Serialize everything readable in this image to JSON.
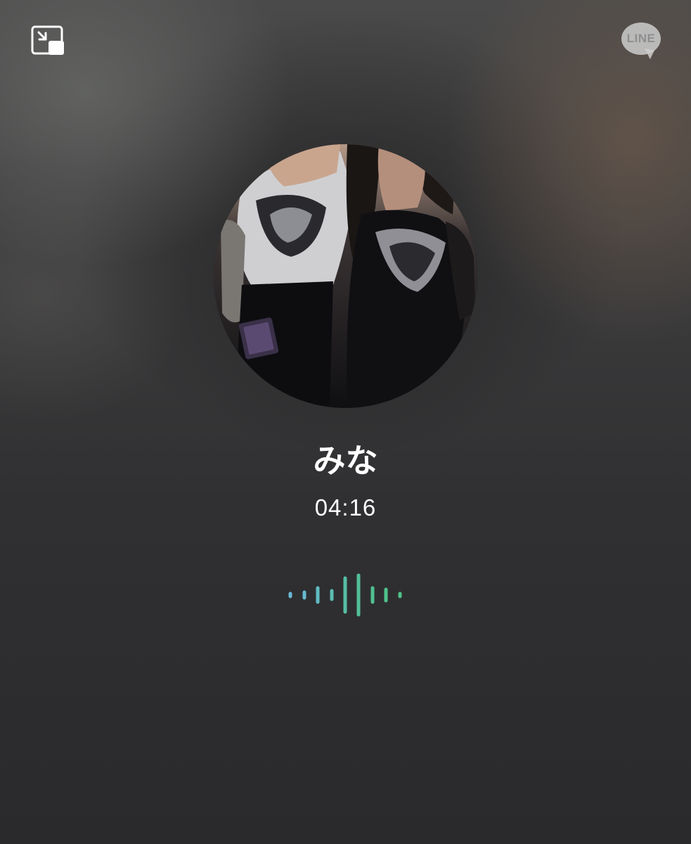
{
  "call": {
    "caller_name": "みな",
    "duration": "04:16"
  },
  "top_bar": {
    "pip_icon": "picture-in-picture-icon",
    "logo_text": "LINE"
  },
  "avatar": {
    "icon": "profile-photo"
  },
  "voice_indicator": {
    "icon": "audio-waveform-icon",
    "colors": [
      "#6ab8d6",
      "#4fc28a"
    ]
  }
}
